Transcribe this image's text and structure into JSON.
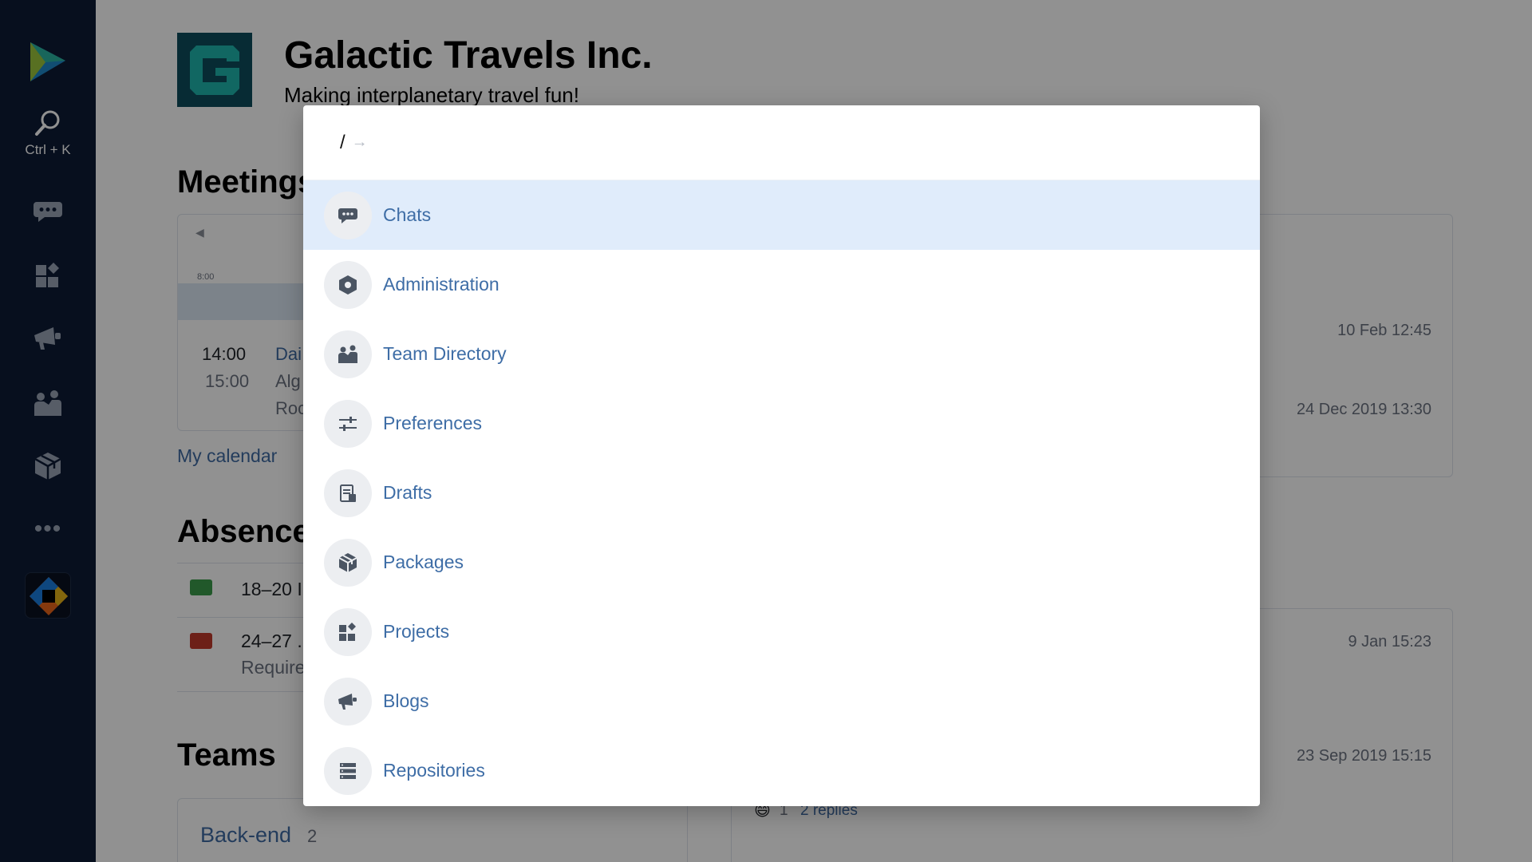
{
  "sidebar": {
    "search_shortcut": "Ctrl + K",
    "more_label": "•••",
    "items": [
      {
        "icon": "search-icon"
      },
      {
        "icon": "chat-icon"
      },
      {
        "icon": "projects-icon"
      },
      {
        "icon": "blogs-icon"
      },
      {
        "icon": "team-directory-icon"
      },
      {
        "icon": "packages-icon"
      }
    ]
  },
  "page": {
    "org_name": "Galactic Travels Inc.",
    "tagline": "Making interplanetary travel fun!",
    "meetings_heading": "Meetings",
    "calendar_hour": "8:00",
    "meeting": {
      "start": "14:00",
      "end": "15:00",
      "title_fragment": "Dai",
      "people_fragment": "Alg",
      "room_fragment": "Roc"
    },
    "my_calendar_link": "My calendar",
    "absences_heading": "Absences",
    "absences": [
      {
        "dates": "18–20 I",
        "color": "#3b9b4a"
      },
      {
        "dates": "24–27 .",
        "note": "Require",
        "color": "#c0392b"
      }
    ],
    "teams_heading": "Teams",
    "team": {
      "name": "Back-end",
      "count": "2"
    },
    "timestamps": [
      "10 Feb 12:45",
      "24 Dec 2019 13:30",
      "9 Jan 15:23",
      "23 Sep 2019 15:15"
    ],
    "reaction_count": "1",
    "replies": "2 replies"
  },
  "palette": {
    "input_prefix": "/",
    "input_arrow": "→",
    "items": [
      {
        "label": "Chats",
        "icon": "chat-icon"
      },
      {
        "label": "Administration",
        "icon": "hexagon-icon"
      },
      {
        "label": "Team Directory",
        "icon": "team-directory-icon"
      },
      {
        "label": "Preferences",
        "icon": "sliders-icon"
      },
      {
        "label": "Drafts",
        "icon": "drafts-icon"
      },
      {
        "label": "Packages",
        "icon": "packages-icon"
      },
      {
        "label": "Projects",
        "icon": "projects-icon"
      },
      {
        "label": "Blogs",
        "icon": "blogs-icon"
      },
      {
        "label": "Repositories",
        "icon": "repositories-icon"
      }
    ]
  },
  "colors": {
    "sidebar_bg": "#0d1b36",
    "accent_link": "#3e6da6",
    "selected_row": "#e0ecfb",
    "logo_bg": "#0e4d5c",
    "logo_mark": "#1fb6ad"
  }
}
